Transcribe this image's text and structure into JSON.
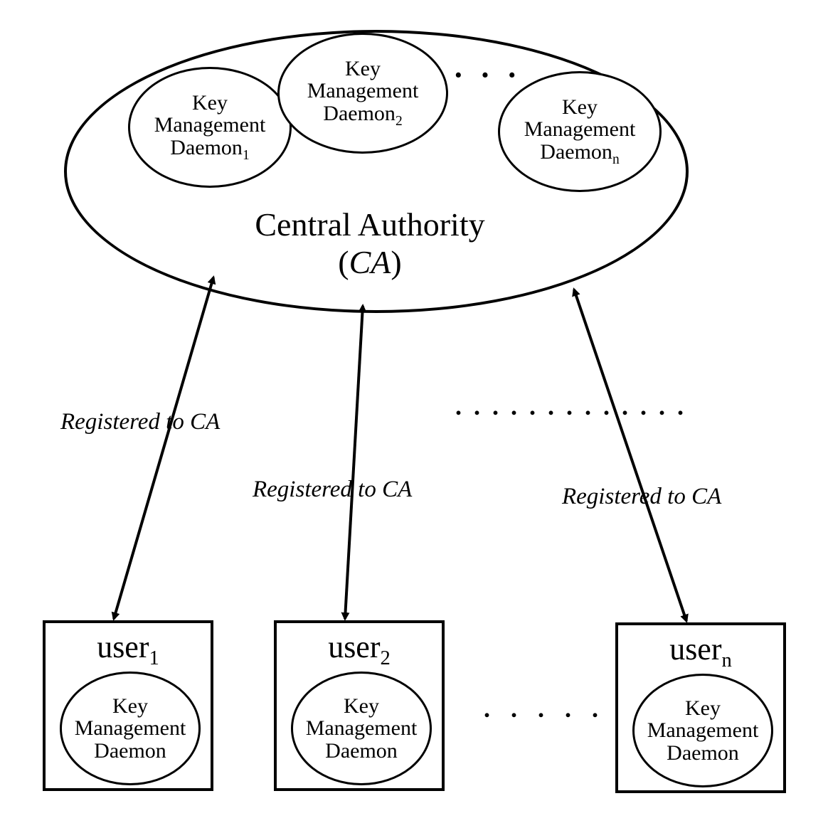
{
  "ca": {
    "title_line1": "Central Authority",
    "title_line2_before": "(",
    "title_line2_ital": "CA",
    "title_line2_after": ")",
    "daemons": [
      {
        "line1": "Key",
        "line2": "Management",
        "line3": "Daemon",
        "sub": "1"
      },
      {
        "line1": "Key",
        "line2": "Management",
        "line3": "Daemon",
        "sub": "2"
      },
      {
        "line1": "Key",
        "line2": "Management",
        "line3": "Daemon",
        "sub": "n"
      }
    ],
    "daemon_ellipsis": "· · ·"
  },
  "edges": {
    "label": "Registered to CA",
    "midline_dots": ". . . . . . . . . . . . ."
  },
  "users": [
    {
      "title_prefix": "user",
      "title_sub": "1",
      "daemon": {
        "line1": "Key",
        "line2": "Management",
        "line3": "Daemon"
      }
    },
    {
      "title_prefix": "user",
      "title_sub": "2",
      "daemon": {
        "line1": "Key",
        "line2": "Management",
        "line3": "Daemon"
      }
    },
    {
      "title_prefix": "user",
      "title_sub": "n",
      "daemon": {
        "line1": "Key",
        "line2": "Management",
        "line3": "Daemon"
      }
    }
  ],
  "user_ellipsis": ". . . . ."
}
